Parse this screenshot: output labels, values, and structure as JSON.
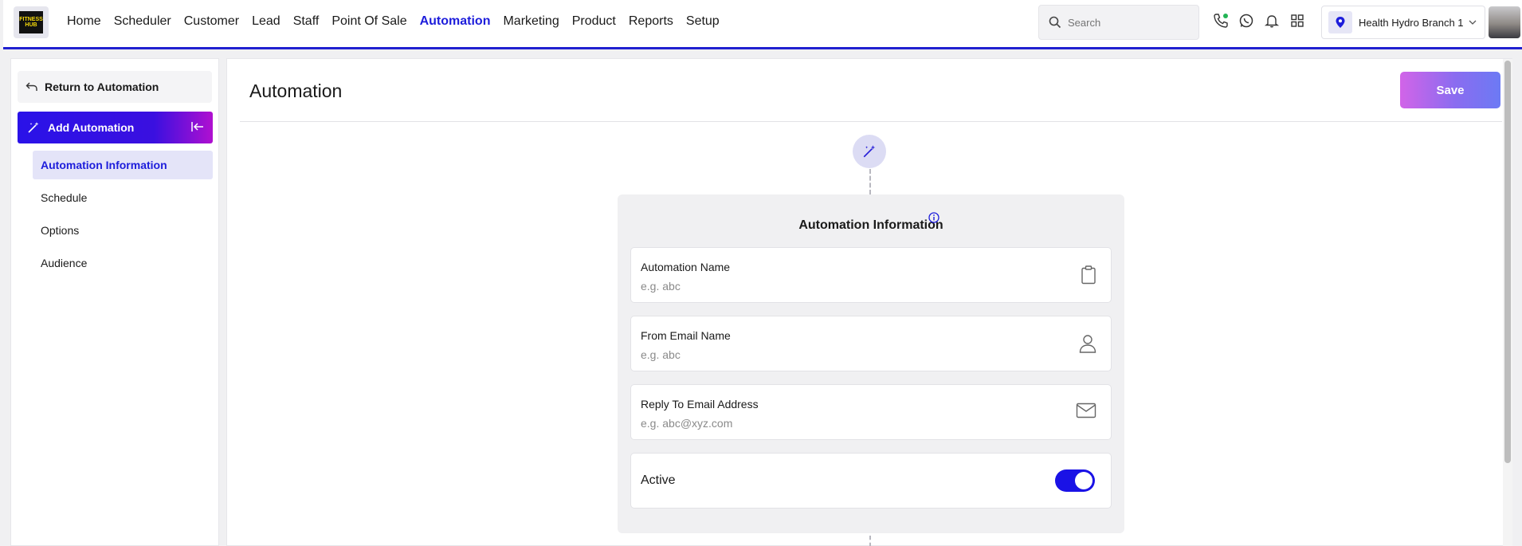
{
  "nav": {
    "logo_text": "FITNESS HUB",
    "items": [
      "Home",
      "Scheduler",
      "Customer",
      "Lead",
      "Staff",
      "Point Of Sale",
      "Automation",
      "Marketing",
      "Product",
      "Reports",
      "Setup"
    ],
    "active": "Automation",
    "search_placeholder": "Search",
    "branch": "Health Hydro Branch 1"
  },
  "sidebar": {
    "return_label": "Return to Automation",
    "add_label": "Add Automation",
    "items": [
      {
        "label": "Automation Information",
        "active": true
      },
      {
        "label": "Schedule",
        "active": false
      },
      {
        "label": "Options",
        "active": false
      },
      {
        "label": "Audience",
        "active": false
      }
    ]
  },
  "main": {
    "title": "Automation",
    "save_label": "Save",
    "card": {
      "title": "Automation Information",
      "fields": [
        {
          "label": "Automation Name",
          "placeholder": "e.g. abc",
          "icon": "clipboard-icon"
        },
        {
          "label": "From Email Name",
          "placeholder": "e.g. abc",
          "icon": "user-icon"
        },
        {
          "label": "Reply To Email Address",
          "placeholder": "e.g. abc@xyz.com",
          "icon": "mail-icon"
        }
      ],
      "active_label": "Active",
      "active_value": true
    }
  },
  "colors": {
    "accent": "#1d1ddb",
    "save_gradient_start": "#d264e8",
    "save_gradient_end": "#6c7af4"
  }
}
